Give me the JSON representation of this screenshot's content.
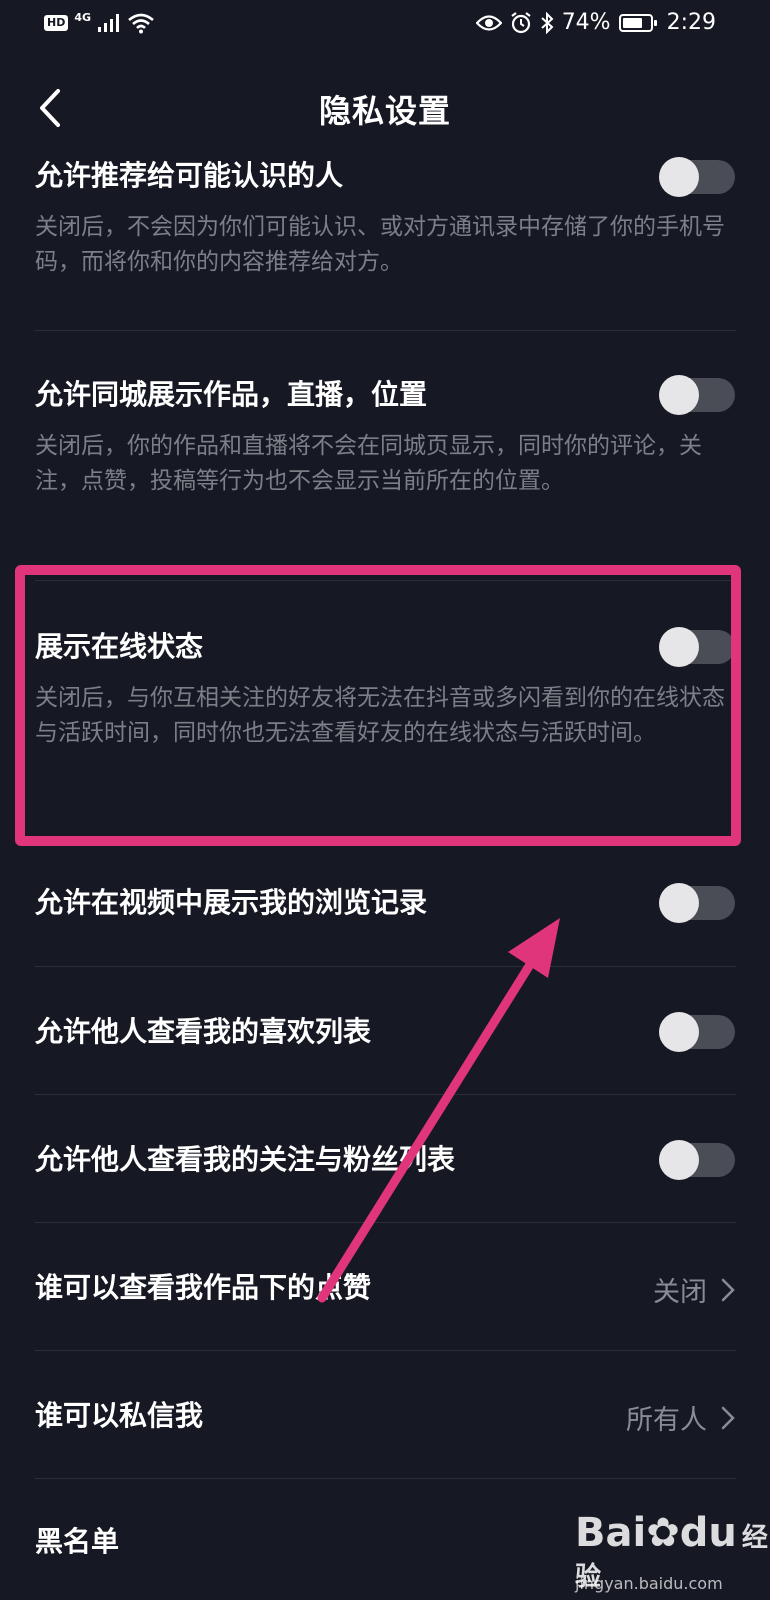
{
  "status_bar": {
    "hd": "HD",
    "network": "4G",
    "battery_percent": "74%",
    "battery_level": 0.74,
    "time": "2:29",
    "icons": [
      "eye-icon",
      "alarm-icon",
      "bluetooth-icon"
    ]
  },
  "header": {
    "title": "隐私设置"
  },
  "settings": [
    {
      "title": "允许推荐给可能认识的人",
      "desc": "关闭后，不会因为你们可能认识、或对方通讯录中存储了你的手机号码，而将你和你的内容推荐给对方。",
      "enabled": false
    },
    {
      "title": "允许同城展示作品，直播，位置",
      "desc": "关闭后，你的作品和直播将不会在同城页显示，同时你的评论，关注，点赞，投稿等行为也不会显示当前所在的位置。",
      "enabled": false
    },
    {
      "title": "展示在线状态",
      "desc": "关闭后，与你互相关注的好友将无法在抖音或多闪看到你的在线状态与活跃时间，同时你也无法查看好友的在线状态与活跃时间。",
      "enabled": false
    },
    {
      "title": "允许在视频中展示我的浏览记录",
      "enabled": false
    },
    {
      "title": "允许他人查看我的喜欢列表",
      "enabled": false
    },
    {
      "title": "允许他人查看我的关注与粉丝列表",
      "enabled": false
    },
    {
      "title": "谁可以查看我作品下的点赞",
      "value": "关闭"
    },
    {
      "title": "谁可以私信我",
      "value": "所有人"
    },
    {
      "title": "黑名单"
    }
  ],
  "watermark": {
    "logo": "Bai",
    "logo_tail": "du",
    "cn": "经验",
    "url": "jingyan.baidu.com"
  },
  "colors": {
    "background": "#161823",
    "annotation": "#e0357a",
    "toggle_track": "#4a4c56",
    "toggle_knob": "#e6e6e8"
  }
}
